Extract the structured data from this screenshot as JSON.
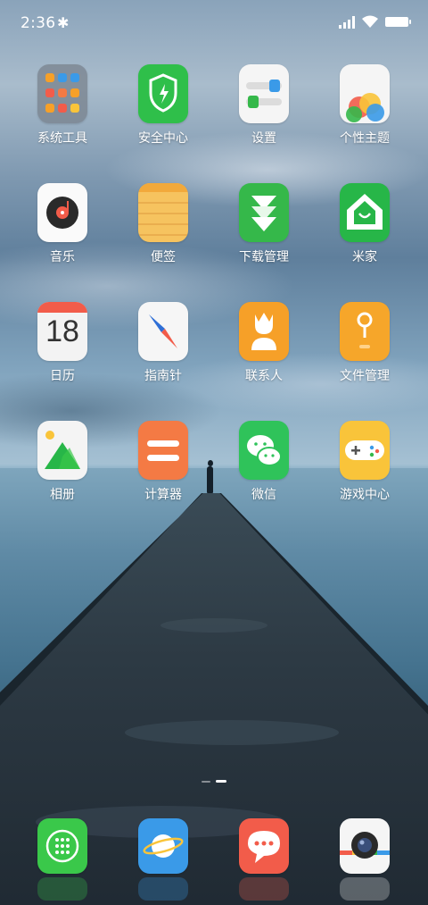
{
  "status_bar": {
    "time": "2:36",
    "bluetooth_icon": "bluetooth-icon",
    "signal_icon": "cell-signal-icon",
    "wifi_icon": "wifi-icon",
    "battery_icon": "battery-icon",
    "battery_level": 1.0
  },
  "grid": [
    {
      "label": "系统工具",
      "icon": "folder-system-tools-icon"
    },
    {
      "label": "安全中心",
      "icon": "shield-bolt-icon",
      "color": "#2fbf4a"
    },
    {
      "label": "设置",
      "icon": "settings-toggles-icon",
      "color": "#f5f5f5"
    },
    {
      "label": "个性主题",
      "icon": "themes-balloons-icon",
      "color": "#f5f5f5"
    },
    {
      "label": "音乐",
      "icon": "music-disc-icon",
      "color": "#fafafa"
    },
    {
      "label": "便签",
      "icon": "notes-lines-icon",
      "color": "#f6c35f"
    },
    {
      "label": "下载管理",
      "icon": "download-arrows-icon",
      "color": "#35b84a"
    },
    {
      "label": "米家",
      "icon": "mi-home-house-icon",
      "color": "#27b648"
    },
    {
      "label": "日历",
      "icon": "calendar-icon",
      "day": "18",
      "color": "#f3f3f3"
    },
    {
      "label": "指南针",
      "icon": "compass-needle-icon",
      "color": "#f6f6f6"
    },
    {
      "label": "联系人",
      "icon": "contacts-person-icon",
      "color": "#f6a028"
    },
    {
      "label": "文件管理",
      "icon": "file-manager-pin-icon",
      "color": "#f6a62a"
    },
    {
      "label": "相册",
      "icon": "gallery-mountain-icon",
      "color": "#f4f4f4"
    },
    {
      "label": "计算器",
      "icon": "calculator-bars-icon",
      "color": "#f47a44"
    },
    {
      "label": "微信",
      "icon": "wechat-bubbles-icon",
      "color": "#2fc35a"
    },
    {
      "label": "游戏中心",
      "icon": "game-controller-icon",
      "color": "#f9c43a"
    }
  ],
  "page_indicator": {
    "pages": 2,
    "current": 2
  },
  "dock": [
    {
      "name": "phone-keypad-icon",
      "color": "#3ac84a"
    },
    {
      "name": "browser-planet-icon",
      "color": "#3a9ae8"
    },
    {
      "name": "messages-bubble-icon",
      "color": "#f25c4a"
    },
    {
      "name": "camera-lens-icon",
      "color": "#f5f5f5"
    }
  ]
}
